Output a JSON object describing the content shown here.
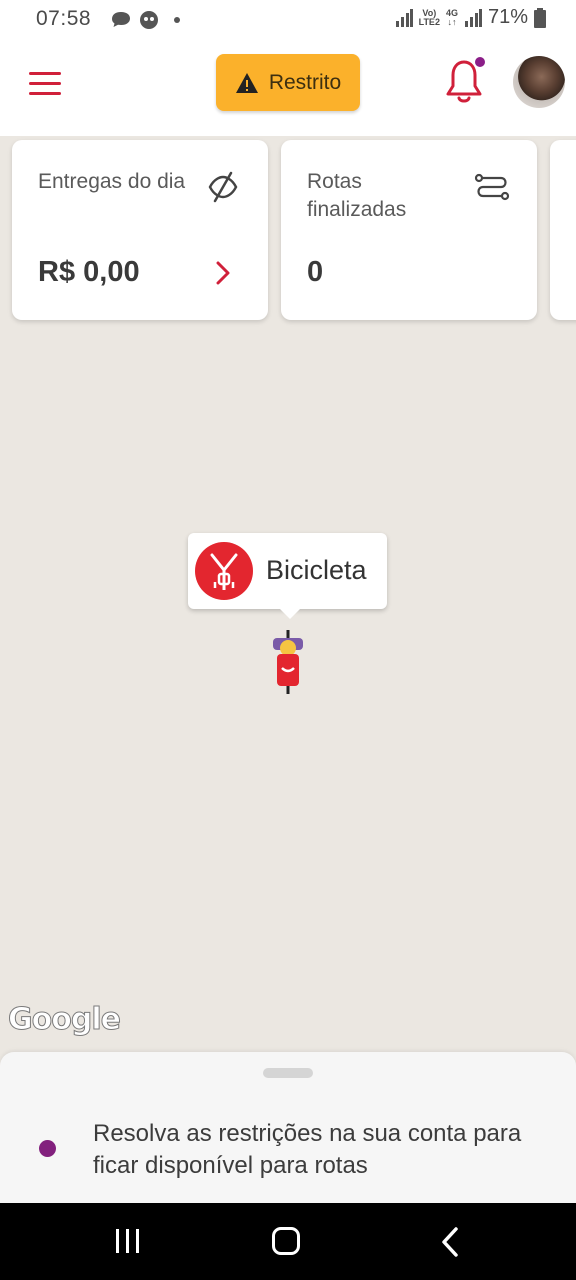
{
  "status_bar": {
    "time": "07:58",
    "network_top": "Vo)",
    "network_bottom": "LTE2",
    "network2_top": "4G",
    "network2_bottom": "↓↑",
    "battery": "71%"
  },
  "header": {
    "status_label": "Restrito"
  },
  "cards": [
    {
      "label": "Entregas do dia",
      "value": "R$ 0,00"
    },
    {
      "label": "Rotas finalizadas",
      "value": "0"
    }
  ],
  "map": {
    "vehicle_label": "Bicicleta",
    "attribution": "Google"
  },
  "bottom_sheet": {
    "message": "Resolva as restrições na sua conta para ficar disponível para rotas"
  },
  "colors": {
    "brand_red": "#d0203a",
    "warning": "#fbb12b",
    "accent_purple": "#82207d"
  }
}
